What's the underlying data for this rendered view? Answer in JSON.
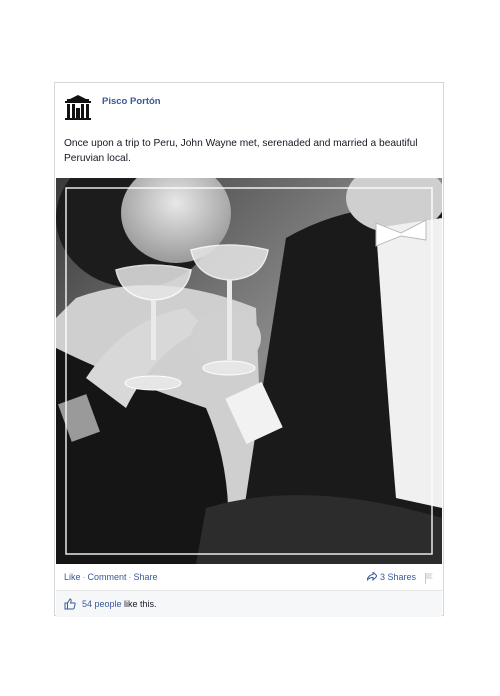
{
  "post": {
    "page_name": "Pisco Portón",
    "text": "Once upon a trip to Peru, John Wayne met, serenaded and married a beautiful Peruvian local.",
    "avatar_icon": "building-logo-icon",
    "photo_description_icon": "photo-couple-toast-icon"
  },
  "actions": {
    "like": "Like",
    "comment": "Comment",
    "share": "Share",
    "separator": "·",
    "shares_count": "3 Shares"
  },
  "likes": {
    "count_text": "54 people",
    "suffix": " like this."
  },
  "colors": {
    "link": "#3b5998",
    "text": "#141823",
    "border": "#d3d6db"
  }
}
